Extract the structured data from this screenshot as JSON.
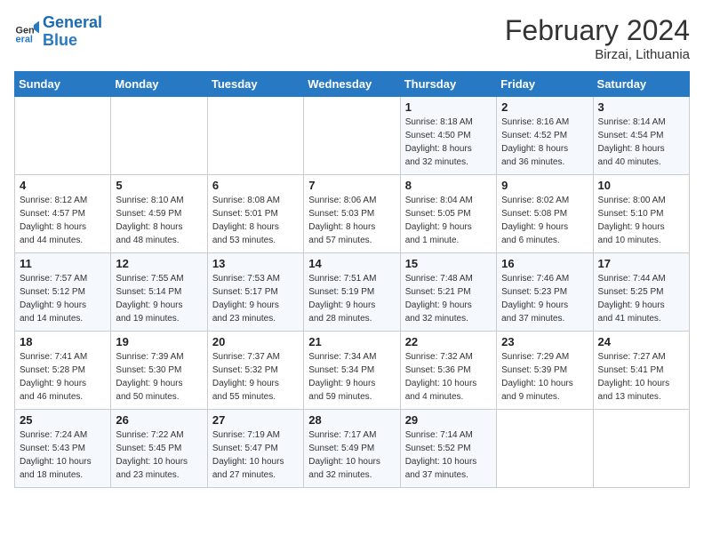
{
  "header": {
    "logo_text_general": "General",
    "logo_text_blue": "Blue",
    "month_title": "February 2024",
    "location": "Birzai, Lithuania"
  },
  "days_of_week": [
    "Sunday",
    "Monday",
    "Tuesday",
    "Wednesday",
    "Thursday",
    "Friday",
    "Saturday"
  ],
  "weeks": [
    [
      {
        "day": "",
        "content": ""
      },
      {
        "day": "",
        "content": ""
      },
      {
        "day": "",
        "content": ""
      },
      {
        "day": "",
        "content": ""
      },
      {
        "day": "1",
        "content": "Sunrise: 8:18 AM\nSunset: 4:50 PM\nDaylight: 8 hours\nand 32 minutes."
      },
      {
        "day": "2",
        "content": "Sunrise: 8:16 AM\nSunset: 4:52 PM\nDaylight: 8 hours\nand 36 minutes."
      },
      {
        "day": "3",
        "content": "Sunrise: 8:14 AM\nSunset: 4:54 PM\nDaylight: 8 hours\nand 40 minutes."
      }
    ],
    [
      {
        "day": "4",
        "content": "Sunrise: 8:12 AM\nSunset: 4:57 PM\nDaylight: 8 hours\nand 44 minutes."
      },
      {
        "day": "5",
        "content": "Sunrise: 8:10 AM\nSunset: 4:59 PM\nDaylight: 8 hours\nand 48 minutes."
      },
      {
        "day": "6",
        "content": "Sunrise: 8:08 AM\nSunset: 5:01 PM\nDaylight: 8 hours\nand 53 minutes."
      },
      {
        "day": "7",
        "content": "Sunrise: 8:06 AM\nSunset: 5:03 PM\nDaylight: 8 hours\nand 57 minutes."
      },
      {
        "day": "8",
        "content": "Sunrise: 8:04 AM\nSunset: 5:05 PM\nDaylight: 9 hours\nand 1 minute."
      },
      {
        "day": "9",
        "content": "Sunrise: 8:02 AM\nSunset: 5:08 PM\nDaylight: 9 hours\nand 6 minutes."
      },
      {
        "day": "10",
        "content": "Sunrise: 8:00 AM\nSunset: 5:10 PM\nDaylight: 9 hours\nand 10 minutes."
      }
    ],
    [
      {
        "day": "11",
        "content": "Sunrise: 7:57 AM\nSunset: 5:12 PM\nDaylight: 9 hours\nand 14 minutes."
      },
      {
        "day": "12",
        "content": "Sunrise: 7:55 AM\nSunset: 5:14 PM\nDaylight: 9 hours\nand 19 minutes."
      },
      {
        "day": "13",
        "content": "Sunrise: 7:53 AM\nSunset: 5:17 PM\nDaylight: 9 hours\nand 23 minutes."
      },
      {
        "day": "14",
        "content": "Sunrise: 7:51 AM\nSunset: 5:19 PM\nDaylight: 9 hours\nand 28 minutes."
      },
      {
        "day": "15",
        "content": "Sunrise: 7:48 AM\nSunset: 5:21 PM\nDaylight: 9 hours\nand 32 minutes."
      },
      {
        "day": "16",
        "content": "Sunrise: 7:46 AM\nSunset: 5:23 PM\nDaylight: 9 hours\nand 37 minutes."
      },
      {
        "day": "17",
        "content": "Sunrise: 7:44 AM\nSunset: 5:25 PM\nDaylight: 9 hours\nand 41 minutes."
      }
    ],
    [
      {
        "day": "18",
        "content": "Sunrise: 7:41 AM\nSunset: 5:28 PM\nDaylight: 9 hours\nand 46 minutes."
      },
      {
        "day": "19",
        "content": "Sunrise: 7:39 AM\nSunset: 5:30 PM\nDaylight: 9 hours\nand 50 minutes."
      },
      {
        "day": "20",
        "content": "Sunrise: 7:37 AM\nSunset: 5:32 PM\nDaylight: 9 hours\nand 55 minutes."
      },
      {
        "day": "21",
        "content": "Sunrise: 7:34 AM\nSunset: 5:34 PM\nDaylight: 9 hours\nand 59 minutes."
      },
      {
        "day": "22",
        "content": "Sunrise: 7:32 AM\nSunset: 5:36 PM\nDaylight: 10 hours\nand 4 minutes."
      },
      {
        "day": "23",
        "content": "Sunrise: 7:29 AM\nSunset: 5:39 PM\nDaylight: 10 hours\nand 9 minutes."
      },
      {
        "day": "24",
        "content": "Sunrise: 7:27 AM\nSunset: 5:41 PM\nDaylight: 10 hours\nand 13 minutes."
      }
    ],
    [
      {
        "day": "25",
        "content": "Sunrise: 7:24 AM\nSunset: 5:43 PM\nDaylight: 10 hours\nand 18 minutes."
      },
      {
        "day": "26",
        "content": "Sunrise: 7:22 AM\nSunset: 5:45 PM\nDaylight: 10 hours\nand 23 minutes."
      },
      {
        "day": "27",
        "content": "Sunrise: 7:19 AM\nSunset: 5:47 PM\nDaylight: 10 hours\nand 27 minutes."
      },
      {
        "day": "28",
        "content": "Sunrise: 7:17 AM\nSunset: 5:49 PM\nDaylight: 10 hours\nand 32 minutes."
      },
      {
        "day": "29",
        "content": "Sunrise: 7:14 AM\nSunset: 5:52 PM\nDaylight: 10 hours\nand 37 minutes."
      },
      {
        "day": "",
        "content": ""
      },
      {
        "day": "",
        "content": ""
      }
    ]
  ]
}
